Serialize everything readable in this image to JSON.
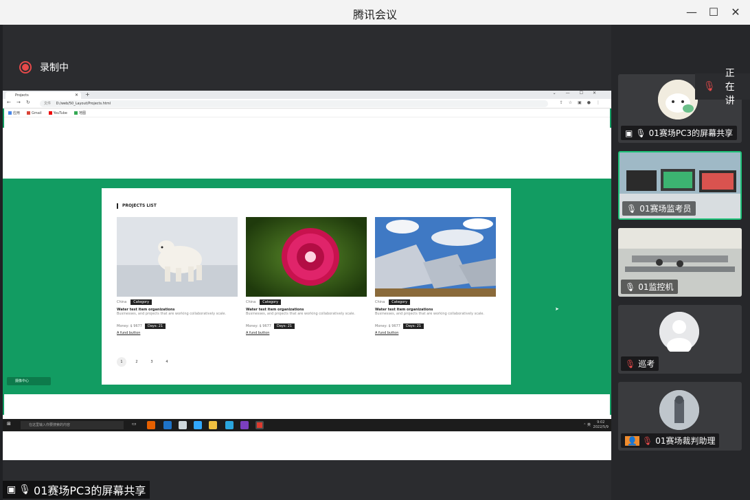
{
  "app": {
    "title": "腾讯会议"
  },
  "window_controls": {
    "minimize": "—",
    "maximize": "☐",
    "close": "✕"
  },
  "recording": {
    "label": "录制中"
  },
  "browser": {
    "tab_title": "Projects",
    "new_tab": "+",
    "url_lock": "文件",
    "url": "D:/web/50_Layout/Projects.html",
    "bookmarks": [
      "应用",
      "Gmail",
      "YouTube",
      "地图"
    ]
  },
  "page": {
    "section_title": "PROJECTS LIST",
    "cards": [
      {
        "location": "China",
        "category": "Category",
        "title": "Water test item organizations",
        "desc": "Businesses, and projects that are working collaboratively scale.",
        "money": "Money: $ 9677",
        "days": "Days: 21",
        "link": "A fund button"
      },
      {
        "location": "China",
        "category": "Category",
        "title": "Water test item organizations",
        "desc": "Businesses, and projects that are working collaboratively scale.",
        "money": "Money: $ 9677",
        "days": "Days: 21",
        "link": "A fund button"
      },
      {
        "location": "China",
        "category": "Category",
        "title": "Water test item organizations",
        "desc": "Businesses, and projects that are working collaboratively scale.",
        "money": "Money: $ 9677",
        "days": "Days: 21",
        "link": "A fund button"
      }
    ],
    "pages": [
      "1",
      "2",
      "3",
      "4"
    ]
  },
  "chip": {
    "label": "摄像中心"
  },
  "taskbar": {
    "search_placeholder": "在这里输入你要搜索的内容",
    "tray": "⌃ 英 ",
    "time": "9:02",
    "date": "2022/5/9"
  },
  "bottom_share": {
    "label": "01赛场PC3的屏幕共享"
  },
  "speaking": {
    "label": "正在讲"
  },
  "participants": [
    {
      "label": "01赛场PC3的屏幕共享"
    },
    {
      "label": "01赛场监考员"
    },
    {
      "label": "01监控机"
    },
    {
      "label": "巡考"
    },
    {
      "label": "01赛场裁判助理"
    }
  ],
  "colors": {
    "accent": "#129c62",
    "record": "#e64a4a",
    "active_border": "#1ec47a"
  }
}
